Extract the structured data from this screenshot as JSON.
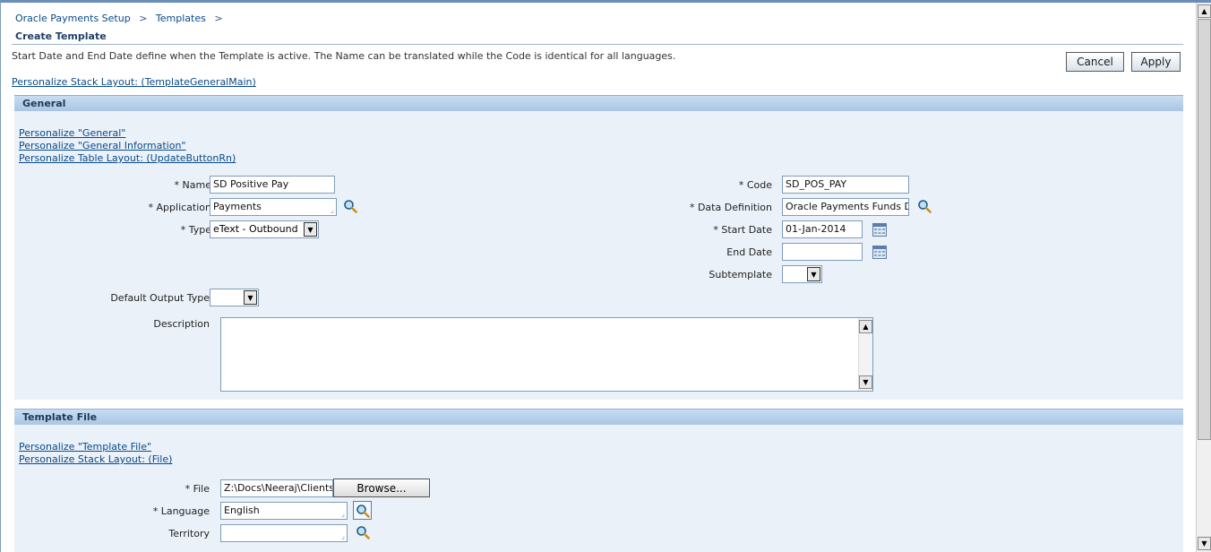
{
  "breadcrumbs": [
    "Oracle Payments Setup",
    "Templates"
  ],
  "breadcrumb_separator": ">",
  "page": {
    "title": "Create Template",
    "instruction": "Start Date and End Date define when the Template is active. The Name can be translated while the Code is identical for all languages.",
    "personalize_stack": "Personalize Stack Layout: (TemplateGeneralMain)",
    "cancel_label": "Cancel",
    "apply_label": "Apply"
  },
  "general": {
    "header": "General",
    "personalize_links": [
      "Personalize \"General\"",
      "Personalize \"General Information\"",
      "Personalize Table Layout: (UpdateButtonRn)"
    ],
    "name_label": "* Name",
    "name_value": "SD Positive Pay",
    "application_label": "* Application",
    "application_value": "Payments",
    "type_label": "* Type",
    "type_value": "eText - Outbound",
    "code_label": "* Code",
    "code_value": "SD_POS_PAY",
    "data_definition_label": "* Data Definition",
    "data_definition_value": "Oracle Payments Funds D",
    "start_date_label": "* Start Date",
    "start_date_value": "01-Jan-2014",
    "end_date_label": "End Date",
    "end_date_value": "",
    "subtemplate_label": "Subtemplate",
    "subtemplate_value": "",
    "default_output_label": "Default Output Type",
    "default_output_value": "",
    "description_label": "Description",
    "description_value": ""
  },
  "template_file": {
    "header": "Template File",
    "personalize_links": [
      "Personalize \"Template File\"",
      "Personalize Stack Layout: (File)"
    ],
    "file_label": "* File",
    "file_value": "Z:\\Docs\\Neeraj\\Clients\\Sm",
    "browse_label": "Browse...",
    "language_label": "* Language",
    "language_value": "English",
    "territory_label": "Territory",
    "territory_value": ""
  },
  "icons": {
    "search": "magnifier-icon",
    "calendar": "calendar-icon"
  },
  "colors": {
    "link": "#0a4a8a",
    "section_header": "#a9c6e3",
    "section_bg": "#eaf1f8"
  }
}
